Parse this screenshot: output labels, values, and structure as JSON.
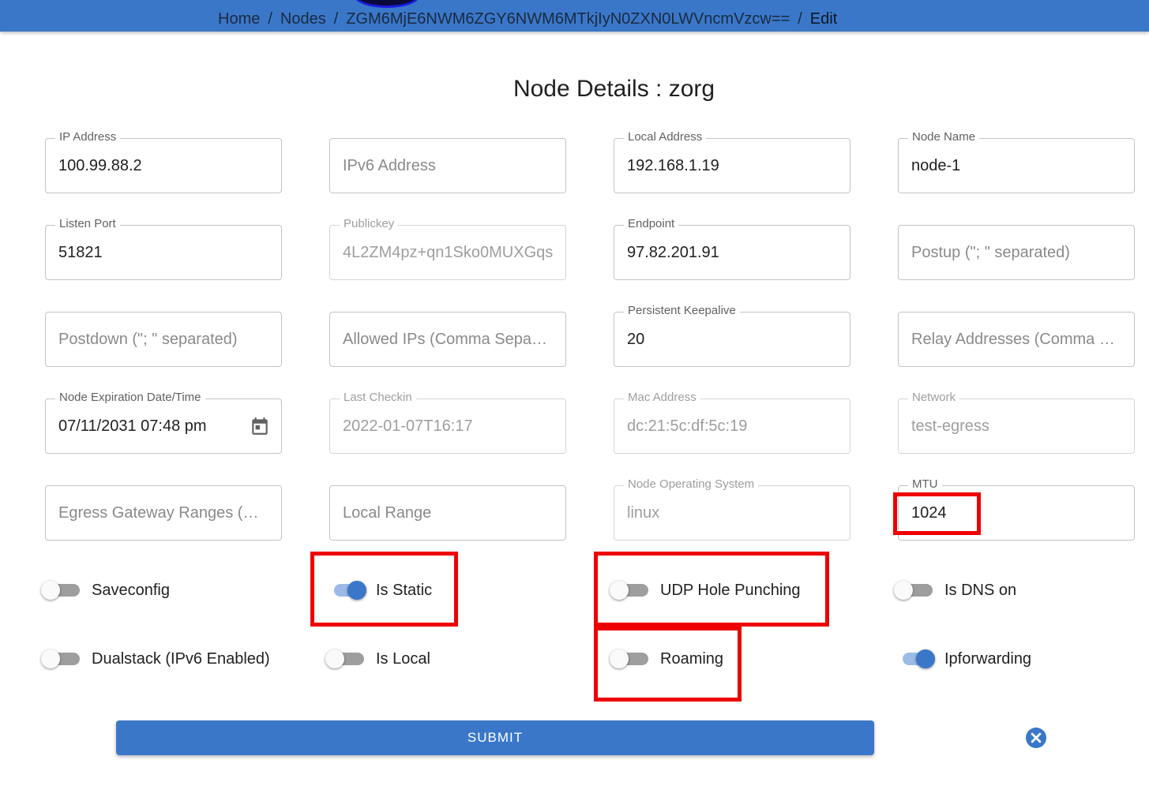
{
  "breadcrumb": {
    "home": "Home",
    "nodes": "Nodes",
    "node_id": "ZGM6MjE6NWM6ZGY6NWM6MTkjIyN0ZXN0LWVncmVzcw==",
    "current": "Edit",
    "separator": "/"
  },
  "title": "Node Details : zorg",
  "fields": {
    "ip_address": {
      "label": "IP Address",
      "value": "100.99.88.2"
    },
    "ipv6_address": {
      "placeholder": "IPv6 Address"
    },
    "local_address": {
      "label": "Local Address",
      "value": "192.168.1.19"
    },
    "node_name": {
      "label": "Node Name",
      "value": "node-1"
    },
    "listen_port": {
      "label": "Listen Port",
      "value": "51821"
    },
    "publickey": {
      "label": "Publickey",
      "value": "4L2ZM4pz+qn1Sko0MUXGqs"
    },
    "endpoint": {
      "label": "Endpoint",
      "value": "97.82.201.91"
    },
    "postup": {
      "placeholder": "Postup (\"; \" separated)"
    },
    "postdown": {
      "placeholder": "Postdown (\"; \" separated)"
    },
    "allowed_ips": {
      "placeholder": "Allowed IPs (Comma Sepa…"
    },
    "persistent_keepalive": {
      "label": "Persistent Keepalive",
      "value": "20"
    },
    "relay_addresses": {
      "placeholder": "Relay Addresses (Comma …"
    },
    "expiration": {
      "label": "Node Expiration Date/Time",
      "value": "07/11/2031 07:48 pm"
    },
    "last_checkin": {
      "label": "Last Checkin",
      "value": "2022-01-07T16:17"
    },
    "mac_address": {
      "label": "Mac Address",
      "value": "dc:21:5c:df:5c:19"
    },
    "network": {
      "label": "Network",
      "value": "test-egress"
    },
    "egress_ranges": {
      "placeholder": "Egress Gateway Ranges (…"
    },
    "local_range": {
      "placeholder": "Local Range"
    },
    "os": {
      "label": "Node Operating System",
      "value": "linux"
    },
    "mtu": {
      "label": "MTU",
      "value": "1024"
    }
  },
  "toggles": {
    "saveconfig": {
      "label": "Saveconfig",
      "on": false
    },
    "is_static": {
      "label": "Is Static",
      "on": true
    },
    "udp_hole_punching": {
      "label": "UDP Hole Punching",
      "on": false
    },
    "is_dns_on": {
      "label": "Is DNS on",
      "on": false
    },
    "dualstack": {
      "label": "Dualstack (IPv6 Enabled)",
      "on": false
    },
    "is_local": {
      "label": "Is Local",
      "on": false
    },
    "roaming": {
      "label": "Roaming",
      "on": false
    },
    "ipforwarding": {
      "label": "Ipforwarding",
      "on": true
    }
  },
  "submit_label": "SUBMIT",
  "icons": {
    "calendar": "calendar-icon",
    "cancel": "close-circle-icon"
  },
  "colors": {
    "primary": "#3a77c9",
    "highlight": "#ee0000",
    "cancel": "#3a77c9"
  }
}
